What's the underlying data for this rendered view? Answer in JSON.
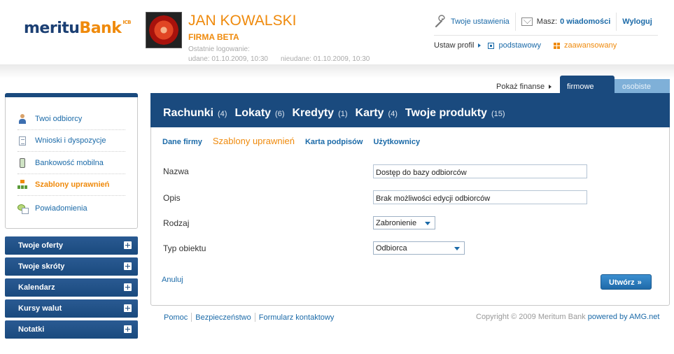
{
  "brand": {
    "logo_main": "meritu",
    "logo_bank": "Bank",
    "logo_mark": "ICB"
  },
  "user": {
    "name": "JAN KOWALSKI",
    "company": "FIRMA BETA",
    "last_login_label": "Ostatnie logowanie:",
    "login_success": "udane: 01.10.2009, 10:30",
    "login_failed": "nieudane: 01.10.2009, 10:30"
  },
  "toplinks": {
    "settings": "Twoje ustawienia",
    "messages_prefix": "Masz:",
    "messages_count": "0 wiadomości",
    "logout": "Wyloguj"
  },
  "profile": {
    "label": "Ustaw profil",
    "basic": "podstawowy",
    "advanced": "zaawansowany"
  },
  "finance": {
    "label": "Pokaż finanse",
    "tab_company": "firmowe",
    "tab_personal": "osobiste"
  },
  "sidebar": {
    "items": [
      {
        "label": "Twoi odbiorcy",
        "icon": "person-icon"
      },
      {
        "label": "Wnioski i dyspozycje",
        "icon": "document-icon"
      },
      {
        "label": "Bankowość mobilna",
        "icon": "phone-icon"
      },
      {
        "label": "Szablony uprawnień",
        "icon": "hierarchy-icon"
      },
      {
        "label": "Powiadomienia",
        "icon": "notification-icon"
      }
    ],
    "active_index": 3,
    "accordions": [
      {
        "label": "Twoje oferty"
      },
      {
        "label": "Twoje skróty"
      },
      {
        "label": "Kalendarz"
      },
      {
        "label": "Kursy walut"
      },
      {
        "label": "Notatki"
      }
    ]
  },
  "nav": {
    "items": [
      {
        "label": "Rachunki",
        "count": "(4)"
      },
      {
        "label": "Lokaty",
        "count": "(6)"
      },
      {
        "label": "Kredyty",
        "count": "(1)"
      },
      {
        "label": "Karty",
        "count": "(4)"
      },
      {
        "label": "Twoje produkty",
        "count": "(15)"
      }
    ]
  },
  "subtabs": [
    {
      "label": "Dane firmy"
    },
    {
      "label": "Szablony uprawnień"
    },
    {
      "label": "Karta podpisów"
    },
    {
      "label": "Użytkownicy"
    }
  ],
  "form": {
    "name_label": "Nazwa",
    "name_value": "Dostęp do bazy odbiorców",
    "desc_label": "Opis",
    "desc_value": "Brak możliwości edycji odbiorców",
    "type_label": "Rodzaj",
    "type_value": "Zabronienie",
    "object_label": "Typ obiektu",
    "object_value": "Odbiorca",
    "cancel": "Anuluj",
    "create": "Utwórz",
    "create_chevron": "»"
  },
  "footer": {
    "links": [
      "Pomoc",
      "Bezpieczeństwo",
      "Formularz kontaktowy"
    ],
    "copyright": "Copyright © 2009 Meritum Bank",
    "powered": "powered by AMG.net"
  },
  "colors": {
    "brand_blue": "#1a4a7e",
    "accent_orange": "#ef8a0c",
    "link_blue": "#1b6aa8"
  }
}
